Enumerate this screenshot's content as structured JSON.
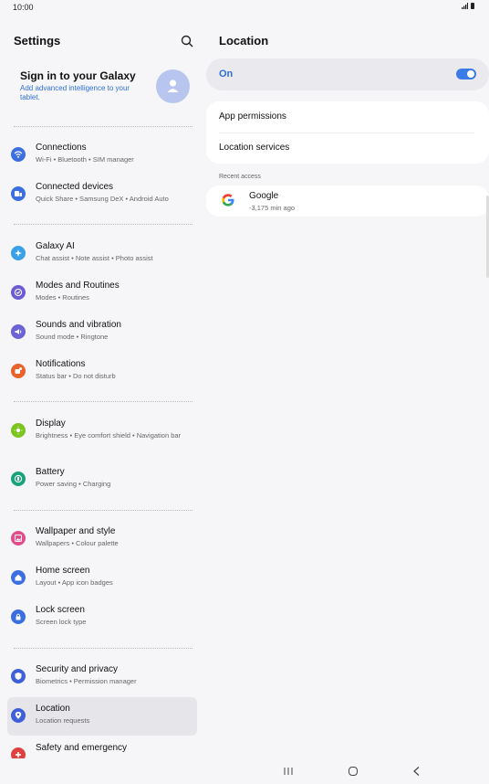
{
  "status": {
    "time": "10:00"
  },
  "left": {
    "title": "Settings",
    "account": {
      "title": "Sign in to your Galaxy",
      "subtitle": "Add advanced intelligence to your tablet."
    },
    "items": [
      {
        "label": "Connections",
        "sub": "Wi-Fi • Bluetooth • SIM manager",
        "color": "#3b6fe0"
      },
      {
        "label": "Connected devices",
        "sub": "Quick Share • Samsung DeX • Android Auto",
        "color": "#3b6fe0"
      },
      {
        "label": "Galaxy AI",
        "sub": "Chat assist • Note assist • Photo assist",
        "color": "#3aa0e8"
      },
      {
        "label": "Modes and Routines",
        "sub": "Modes • Routines",
        "color": "#6b5bd6"
      },
      {
        "label": "Sounds and vibration",
        "sub": "Sound mode • Ringtone",
        "color": "#6b63d6"
      },
      {
        "label": "Notifications",
        "sub": "Status bar • Do not disturb",
        "color": "#e8622a"
      },
      {
        "label": "Display",
        "sub": "Brightness • Eye comfort shield • Navigation bar",
        "color": "#7cc420"
      },
      {
        "label": "Battery",
        "sub": "Power saving • Charging",
        "color": "#1aa37a"
      },
      {
        "label": "Wallpaper and style",
        "sub": "Wallpapers • Colour palette",
        "color": "#e04d8a"
      },
      {
        "label": "Home screen",
        "sub": "Layout • App icon badges",
        "color": "#3b6fe0"
      },
      {
        "label": "Lock screen",
        "sub": "Screen lock type",
        "color": "#3b6fe0"
      },
      {
        "label": "Security and privacy",
        "sub": "Biometrics • Permission manager",
        "color": "#4060d8"
      },
      {
        "label": "Location",
        "sub": "Location requests",
        "color": "#4060d8"
      },
      {
        "label": "Safety and emergency",
        "sub": "",
        "color": "#e04040"
      }
    ]
  },
  "right": {
    "title": "Location",
    "toggle_label": "On",
    "toggle_on": true,
    "options": [
      "App permissions",
      "Location services"
    ],
    "recent_header": "Recent access",
    "recent": [
      {
        "name": "Google",
        "time": "-3,175 min ago"
      }
    ]
  }
}
